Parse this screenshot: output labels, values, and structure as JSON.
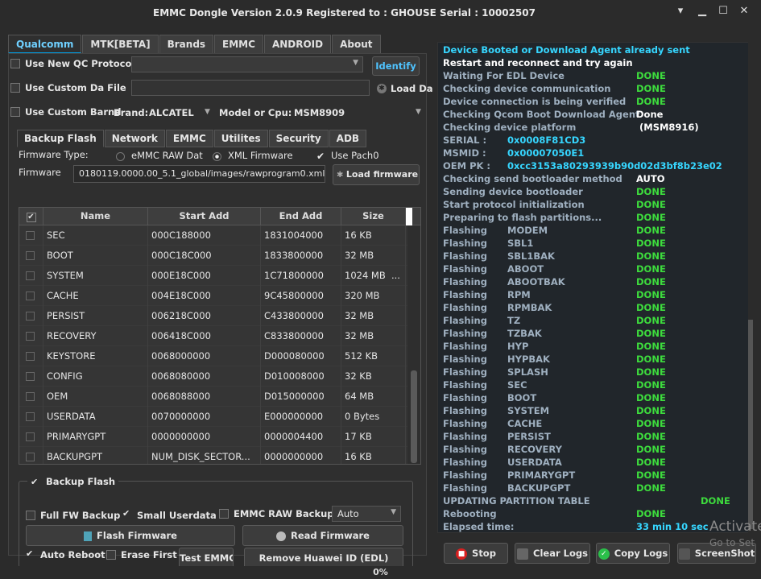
{
  "window": {
    "title": "EMMC Dongle Version 2.0.9 Registered to : GHOUSE   Serial : 10002507"
  },
  "tabs": [
    "Qualcomm",
    "MTK[BETA]",
    "Brands",
    "EMMC",
    "ANDROID",
    "About"
  ],
  "qc": {
    "use_new_qc": "Use New QC Protocol",
    "use_custom_da": "Use Custom Da File",
    "use_custom_brand": "Use Custom Barnd",
    "brand_label": "Brand:",
    "brand_value": "ALCATEL",
    "model_label": "Model or Cpu:",
    "model_value": "MSM8909",
    "identify": "Identify",
    "load_da": "Load Da"
  },
  "subtabs": [
    "Backup  Flash",
    "Network",
    "EMMC",
    "Utilites",
    "Security",
    "ADB"
  ],
  "firmware": {
    "type_label": "Firmware Type:",
    "opt_raw": "eMMC RAW Dat",
    "opt_xml": "XML Firmware",
    "use_patch": "Use Pach0",
    "fw_label": "Firmware",
    "fw_path": "0180119.0000.00_5.1_global/images/rawprogram0.xml",
    "load_btn": "Load firmware fi"
  },
  "table": {
    "headers": [
      "Name",
      "Start Add",
      "End Add",
      "Size"
    ],
    "rows": [
      [
        "SEC",
        "000C188000",
        "1831004000",
        "16 KB"
      ],
      [
        "BOOT",
        "000C18C000",
        "1833800000",
        "32 MB"
      ],
      [
        "SYSTEM",
        "000E18C000",
        "1C71800000",
        "1024 MB"
      ],
      [
        "CACHE",
        "004E18C000",
        "9C45800000",
        "320 MB"
      ],
      [
        "PERSIST",
        "006218C000",
        "C433800000",
        "32 MB"
      ],
      [
        "RECOVERY",
        "006418C000",
        "C833800000",
        "32 MB"
      ],
      [
        "KEYSTORE",
        "0068000000",
        "D000080000",
        "512 KB"
      ],
      [
        "CONFIG",
        "0068080000",
        "D010008000",
        "32 KB"
      ],
      [
        "OEM",
        "0068088000",
        "D015000000",
        "64 MB"
      ],
      [
        "USERDATA",
        "0070000000",
        "E000000000",
        "0 Bytes"
      ],
      [
        "PRIMARYGPT",
        "0000000000",
        "0000004400",
        "17 KB"
      ],
      [
        "BACKUPGPT",
        "NUM_DISK_SECTOR...",
        "0000000000",
        "16 KB"
      ]
    ],
    "ellipsis": "..."
  },
  "group": {
    "title": "Backup  Flash",
    "full_fw": "Full FW Backup",
    "small_userdata": "Small Userdata",
    "emmc_raw": "EMMC RAW Backup",
    "auto_value": "Auto",
    "flash_fw": "Flash Firmware",
    "read_fw": "Read Firmware",
    "auto_reboot": "Auto Reboot",
    "erase_first": "Erase First",
    "test_emmc": "Test EMMC",
    "remove_huawei": "Remove Huawei ID (EDL)"
  },
  "log": [
    {
      "a": "Device Booted or Download Agent already sent",
      "b": "",
      "ca": "#36d6ff",
      "cb": ""
    },
    {
      "a": "Restart and reconnect and try again",
      "b": "",
      "ca": "#ffffff",
      "cb": ""
    },
    {
      "a": "Waiting For EDL Device",
      "b": "DONE",
      "ca": "#9fb0c0",
      "cb": "#3ddc3d"
    },
    {
      "a": "Checking device communication",
      "b": "DONE",
      "ca": "#9fb0c0",
      "cb": "#3ddc3d"
    },
    {
      "a": "Device connection is being verified",
      "b": "DONE",
      "ca": "#9fb0c0",
      "cb": "#3ddc3d"
    },
    {
      "a": "Checking Qcom Boot Download Agent",
      "b": "Done",
      "ca": "#9fb0c0",
      "cb": "#ffffff"
    },
    {
      "a": "Checking device platform",
      "b": "(MSM8916)",
      "ca": "#9fb0c0",
      "cb": "#ffffff"
    },
    {
      "a": "SERIAL :",
      "b": "0x0008F81CD3",
      "ca": "#9fb0c0",
      "cb": "#36d6ff",
      "mid": true
    },
    {
      "a": "MSMID  :",
      "b": "0x00007050E1",
      "ca": "#9fb0c0",
      "cb": "#36d6ff",
      "mid": true
    },
    {
      "a": "OEM PK :",
      "b": "0xcc3153a80293939b90d02d3bf8b23e02",
      "ca": "#9fb0c0",
      "cb": "#36d6ff",
      "mid": true
    },
    {
      "a": "Checking send bootloader method",
      "b": "AUTO",
      "ca": "#9fb0c0",
      "cb": "#ffffff"
    },
    {
      "a": "Sending device bootloader",
      "b": "DONE",
      "ca": "#9fb0c0",
      "cb": "#3ddc3d"
    },
    {
      "a": "Start protocol initialization",
      "b": "DONE",
      "ca": "#9fb0c0",
      "cb": "#3ddc3d"
    },
    {
      "a": "Preparing to flash partitions...",
      "b": "DONE",
      "ca": "#9fb0c0",
      "cb": "#3ddc3d"
    }
  ],
  "flash_parts": [
    "MODEM",
    "SBL1",
    "SBL1BAK",
    "ABOOT",
    "ABOOTBAK",
    "RPM",
    "RPMBAK",
    "TZ",
    "TZBAK",
    "HYP",
    "HYPBAK",
    "SPLASH",
    "SEC",
    "BOOT",
    "SYSTEM",
    "CACHE",
    "PERSIST",
    "RECOVERY",
    "USERDATA",
    "PRIMARYGPT",
    "BACKUPGPT"
  ],
  "flashing_word": "Flashing",
  "done_word": "DONE",
  "log_tail": {
    "updating": "UPDATING PARTITION TABLE",
    "updating_status": "DONE",
    "rebooting": "Rebooting",
    "rebooting_status": "DONE",
    "elapsed": "Elapsed time:",
    "elapsed_value": "33 min  10 sec"
  },
  "actions": {
    "stop": "Stop",
    "clear": "Clear Logs",
    "copy": "Copy Logs",
    "screenshot": "ScreenShot"
  },
  "watermark": {
    "line1": "Activate",
    "line2": "Go to Set"
  },
  "progress": {
    "text": "0%",
    "value": 0
  }
}
